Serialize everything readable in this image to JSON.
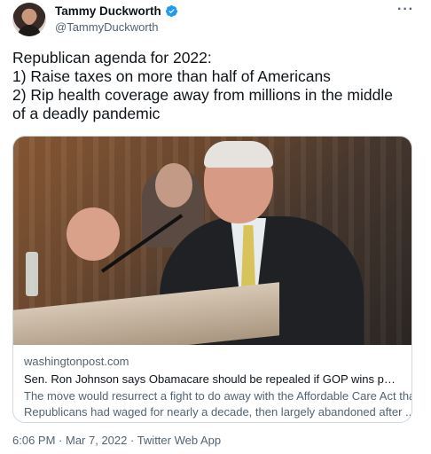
{
  "author": {
    "name": "Tammy Duckworth",
    "handle": "@TammyDuckworth",
    "verified_icon": "verified-badge-icon"
  },
  "more_icon": "more-options-icon",
  "tweet": {
    "lines": [
      "Republican agenda for 2022:",
      "1) Raise taxes on more than half of Americans",
      "2) Rip health coverage away from millions in the middle",
      "of a deadly pandemic"
    ]
  },
  "card": {
    "domain": "washingtonpost.com",
    "title": "Sen. Ron Johnson says Obamacare should be repealed if GOP wins power back",
    "description_lines": [
      "The move would resurrect a fight to do away with the Affordable Care Act that",
      "Republicans had waged for nearly a decade, then largely abandoned after ..."
    ]
  },
  "meta": {
    "time": "6:06 PM",
    "separator": " · ",
    "date": "Mar 7, 2022",
    "source": "Twitter Web App"
  },
  "colors": {
    "text": "#0f1419",
    "secondary": "#536471",
    "verified": "#1d9bf0",
    "border": "#cfd9de"
  }
}
